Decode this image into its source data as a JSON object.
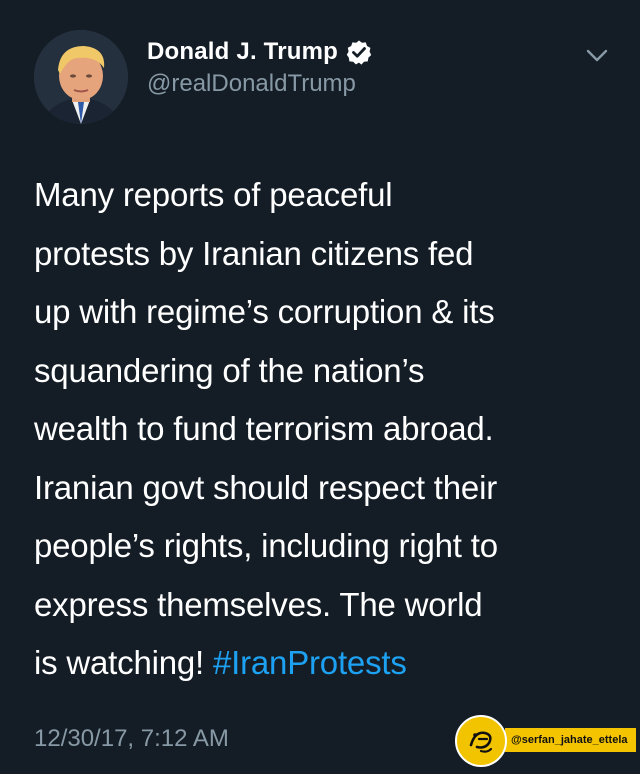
{
  "user": {
    "display_name": "Donald J. Trump",
    "handle": "@realDonaldTrump",
    "verified": true
  },
  "tweet": {
    "text": "Many reports of peaceful\nprotests by Iranian citizens fed\nup with regime’s corruption & its\nsquandering of the nation’s\nwealth to fund terrorism abroad.\nIranian govt should respect their\npeople’s rights, including right to\nexpress themselves. The world\nis watching! ",
    "hashtag": "#IranProtests",
    "timestamp": "12/30/17, 7:12 AM"
  },
  "watermark": {
    "label": "@serfan_jahate_ettela"
  },
  "icons": {
    "verified": "verified-badge-icon",
    "menu": "chevron-down-icon"
  },
  "colors": {
    "background": "#141d26",
    "text_primary": "#ffffff",
    "text_secondary": "#8899a6",
    "hashtag": "#1da1f2",
    "watermark": "#f5c400"
  }
}
